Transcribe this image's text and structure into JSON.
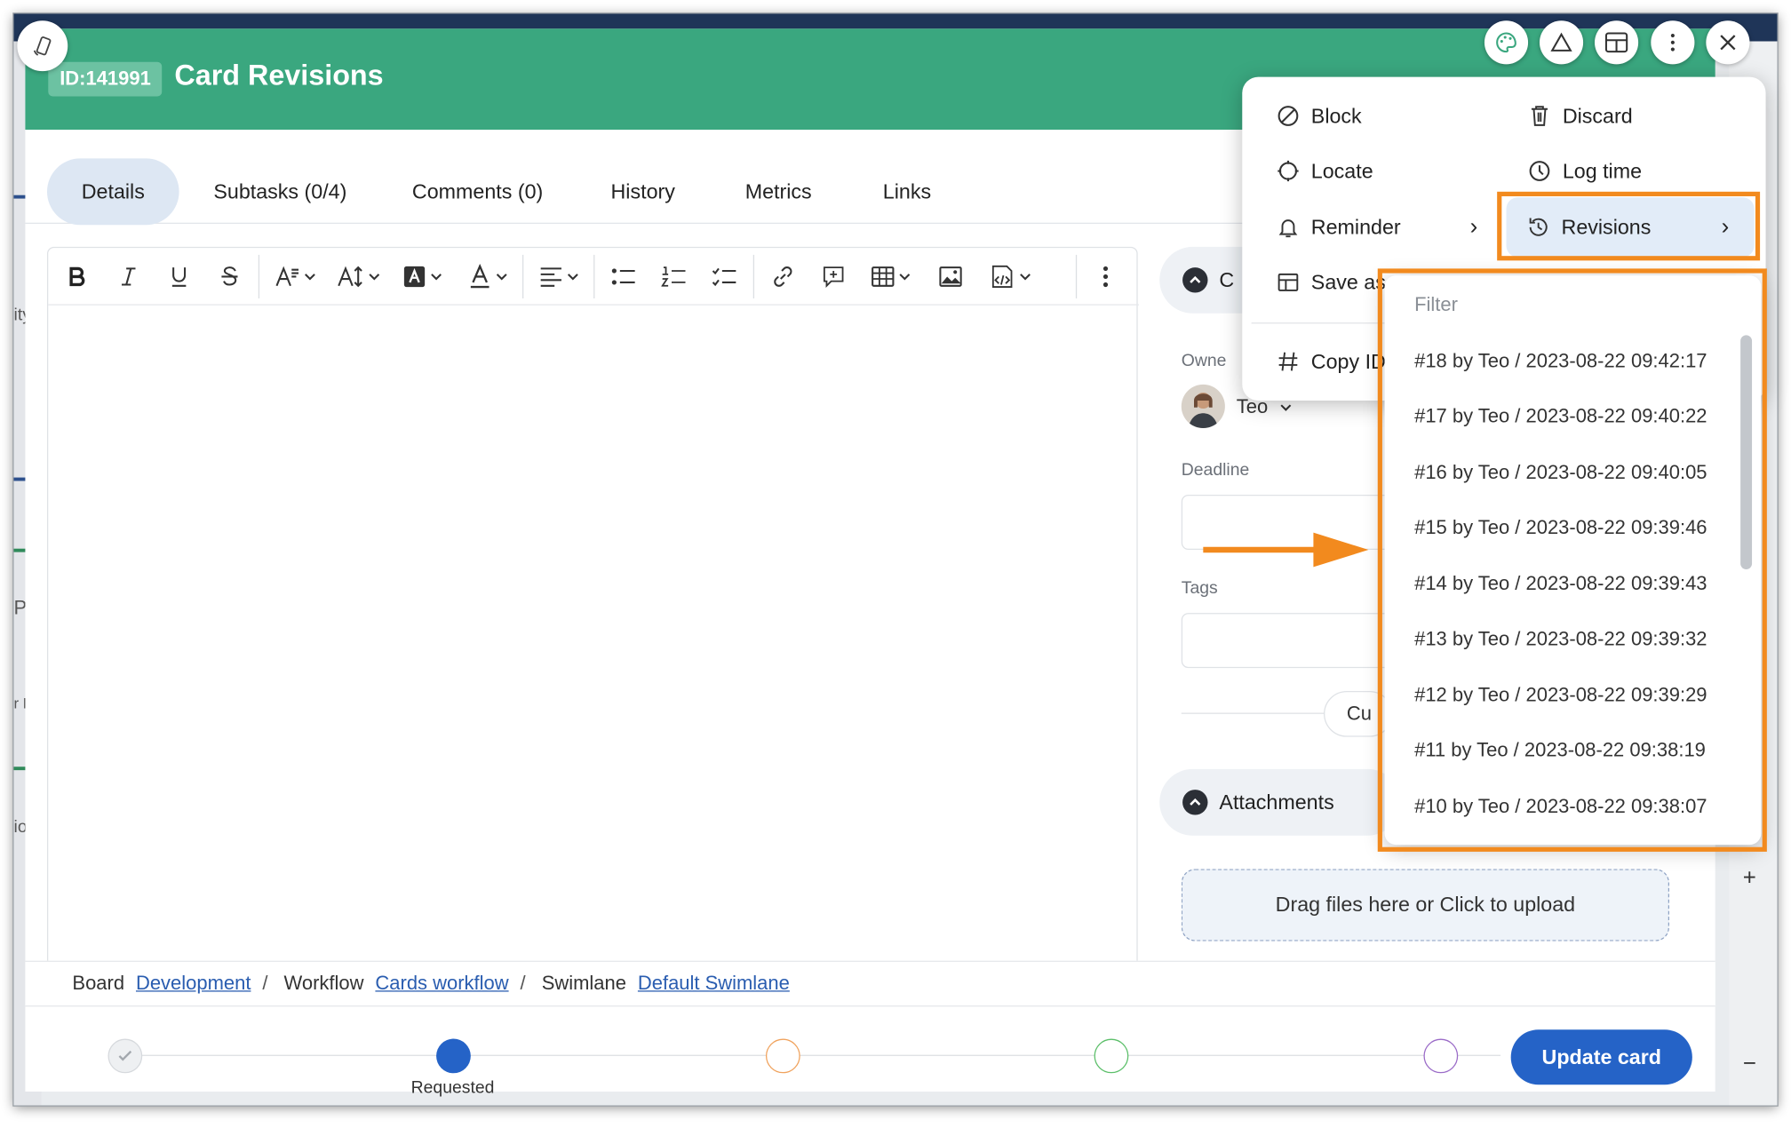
{
  "header": {
    "id_badge": "ID:141991",
    "title": "Card Revisions"
  },
  "tabs": [
    {
      "label": "Details",
      "active": true
    },
    {
      "label": "Subtasks (0/4)"
    },
    {
      "label": "Comments (0)"
    },
    {
      "label": "History"
    },
    {
      "label": "Metrics"
    },
    {
      "label": "Links"
    }
  ],
  "background": {
    "left_texts": [
      "ity",
      "Po",
      "r Po",
      "ior"
    ],
    "right_buttons": [
      "+",
      "−"
    ]
  },
  "sidebar": {
    "section_top_char": "C",
    "owner_label": "Owne",
    "owner_name": "Teo",
    "deadline_label": "Deadline",
    "tags_label": "Tags",
    "custom_partial": "Cu",
    "attachments_title": "Attachments",
    "upload_text": "Drag files here or Click to upload"
  },
  "breadcrumb": {
    "board_label": "Board",
    "board_link": "Development",
    "workflow_label": "Workflow",
    "workflow_link": "Cards workflow",
    "swimlane_label": "Swimlane",
    "swimlane_link": "Default Swimlane",
    "separator": "/"
  },
  "stages": {
    "current_label": "Requested",
    "colors": [
      "#bfc5cc",
      "#2563c7",
      "#f0a35e",
      "#5cbf6a",
      "#9b6cc8"
    ]
  },
  "footer": {
    "update_button": "Update card"
  },
  "actions_menu": {
    "block": "Block",
    "discard": "Discard",
    "locate": "Locate",
    "log_time": "Log time",
    "reminder": "Reminder",
    "revisions": "Revisions",
    "save_as": "Save as",
    "copy_id": "Copy ID",
    "chevron": "›"
  },
  "revisions": {
    "filter_placeholder": "Filter",
    "items": [
      "#18 by Teo / 2023-08-22 09:42:17",
      "#17 by Teo / 2023-08-22 09:40:22",
      "#16 by Teo / 2023-08-22 09:40:05",
      "#15 by Teo / 2023-08-22 09:39:46",
      "#14 by Teo / 2023-08-22 09:39:43",
      "#13 by Teo / 2023-08-22 09:39:32",
      "#12 by Teo / 2023-08-22 09:39:29",
      "#11 by Teo / 2023-08-22 09:38:19",
      "#10 by Teo / 2023-08-22 09:38:07"
    ]
  },
  "colors": {
    "header_green": "#3aa77f",
    "primary_blue": "#2563c7",
    "highlight_orange": "#f28a1e",
    "active_tab_bg": "#dde7f3"
  },
  "icons": {
    "floating": [
      "palette-icon",
      "triangle-icon",
      "layout-icon",
      "more-vertical-icon",
      "close-icon"
    ],
    "top_left": "phone-rotate-icon"
  }
}
